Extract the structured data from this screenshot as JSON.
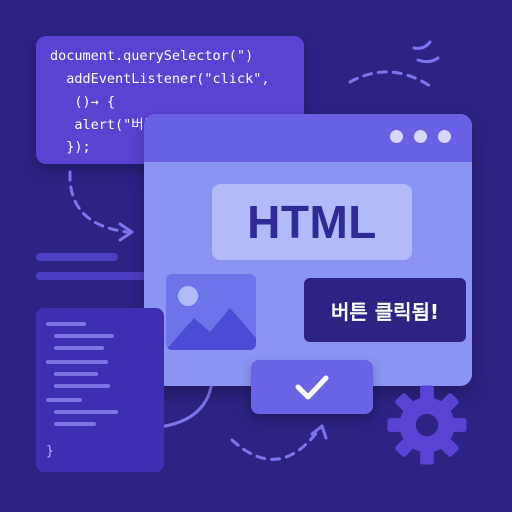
{
  "code_snippet": {
    "lines": [
      "document.querySelector(\")",
      "  addEventListener(\"click\",",
      "   ()→ {",
      "   alert(\"버튼 클릭됨!\");",
      "  });"
    ]
  },
  "window": {
    "banner_text": "HTML",
    "button_text": "버튼 클릭됨!"
  },
  "code_file": {
    "closing_brace": "}"
  },
  "colors": {
    "background": "#2c2384",
    "code_card": "#5a43d3",
    "window": "#8f98f3",
    "banner": "#b3baf8",
    "banner_text": "#2f2a96",
    "clicked_button": "#2c2384",
    "check_button": "#6a63e6",
    "gear": "#5a43d3"
  },
  "icons": {
    "image": "image-placeholder-icon",
    "check": "check-icon",
    "gear": "gear-icon"
  }
}
